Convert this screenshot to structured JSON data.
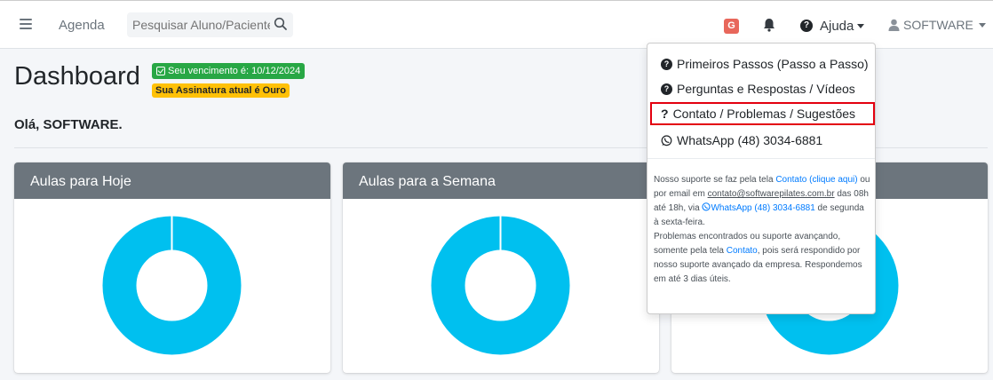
{
  "navbar": {
    "agenda_label": "Agenda",
    "search_placeholder": "Pesquisar Aluno/Paciente",
    "g_badge": "G",
    "help_label": "Ajuda",
    "user_label": "SOFTWARE"
  },
  "header": {
    "title": "Dashboard",
    "due_badge": "Seu vencimento é: 10/12/2024",
    "plan_badge": "Sua Assinatura atual é Ouro",
    "greeting": "Olá, SOFTWARE."
  },
  "cards": [
    {
      "title": "Aulas para Hoje"
    },
    {
      "title": "Aulas para a Semana"
    }
  ],
  "help_menu": {
    "items": [
      {
        "label": "Primeiros Passos (Passo a Passo)"
      },
      {
        "label": "Perguntas e Respostas / Vídeos"
      },
      {
        "label": "Contato / Problemas / Sugestões"
      },
      {
        "label": "WhatsApp (48) 3034-6881"
      }
    ],
    "info": {
      "p1": "Nosso suporte se faz pela tela ",
      "contato_link": "Contato (clique aqui)",
      "p2": " ou por email em ",
      "email": "contato@softwarepilates.com.br",
      "p3": " das 08h até 18h, via ",
      "whatsapp": "WhatsApp (48) 3034-6881",
      "p4": " de segunda à sexta-feira.",
      "p5": "Problemas encontrados ou suporte avançando, somente pela tela ",
      "contato2": "Contato",
      "p6": ", pois será respondido por nosso suporte avançado da empresa. Respondemos em até 3 dias úteis."
    }
  },
  "colors": {
    "donut": "#00c0ef",
    "card_header": "#6c757d",
    "badge_green": "#28a745",
    "badge_yellow": "#ffc107",
    "highlight_border": "#e3000f"
  }
}
